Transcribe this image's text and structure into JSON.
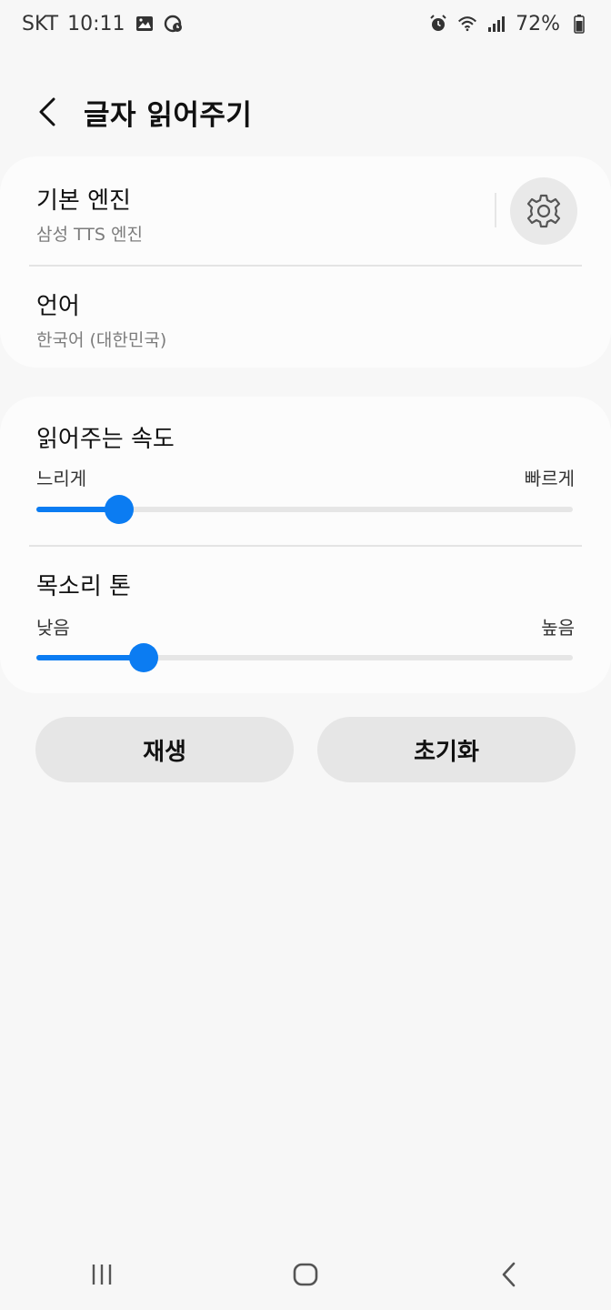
{
  "status_bar": {
    "carrier": "SKT",
    "time": "10:11",
    "battery": "72%"
  },
  "header": {
    "title": "글자 읽어주기"
  },
  "engine": {
    "title": "기본 엔진",
    "value": "삼성 TTS 엔진"
  },
  "language": {
    "title": "언어",
    "value": "한국어 (대한민국)"
  },
  "speech_rate": {
    "title": "읽어주는 속도",
    "min_label": "느리게",
    "max_label": "빠르게",
    "value": 0.155
  },
  "pitch": {
    "title": "목소리 톤",
    "min_label": "낮음",
    "max_label": "높음",
    "value": 0.2
  },
  "actions": {
    "play_label": "재생",
    "reset_label": "초기화"
  },
  "colors": {
    "accent": "#0b7cf2",
    "track": "#e6e6e6",
    "background": "#f7f7f7",
    "card": "#fcfcfc"
  }
}
